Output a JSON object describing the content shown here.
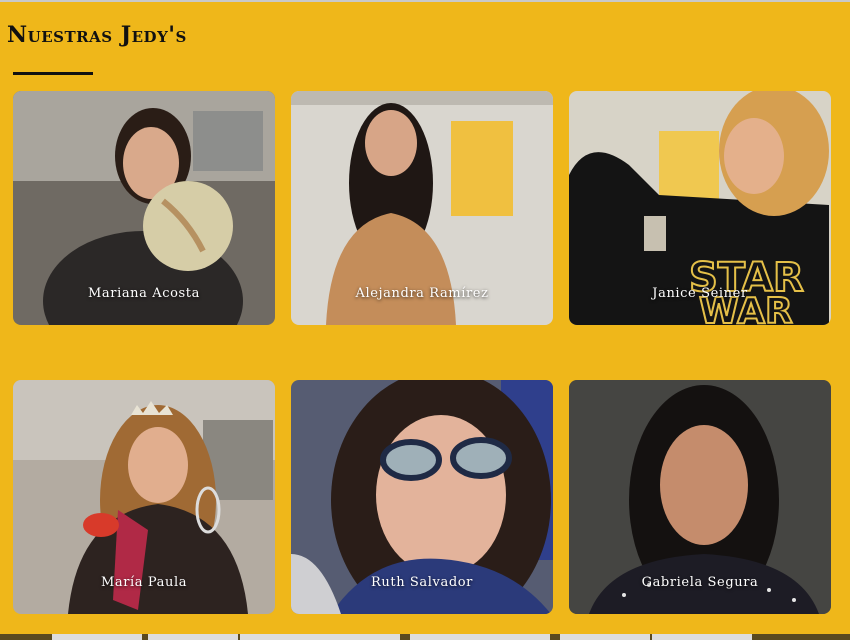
{
  "section": {
    "title": "Nuestras Jedy's"
  },
  "cards": [
    {
      "name": "Mariana Acosta"
    },
    {
      "name": "Alejandra Ramírez"
    },
    {
      "name": "Janice Seiner"
    },
    {
      "name": "María Paula"
    },
    {
      "name": "Ruth Salvador"
    },
    {
      "name": "Gabriela Segura"
    }
  ],
  "colors": {
    "background": "#efb71a",
    "title": "#111111",
    "card_label": "#ffffff"
  }
}
